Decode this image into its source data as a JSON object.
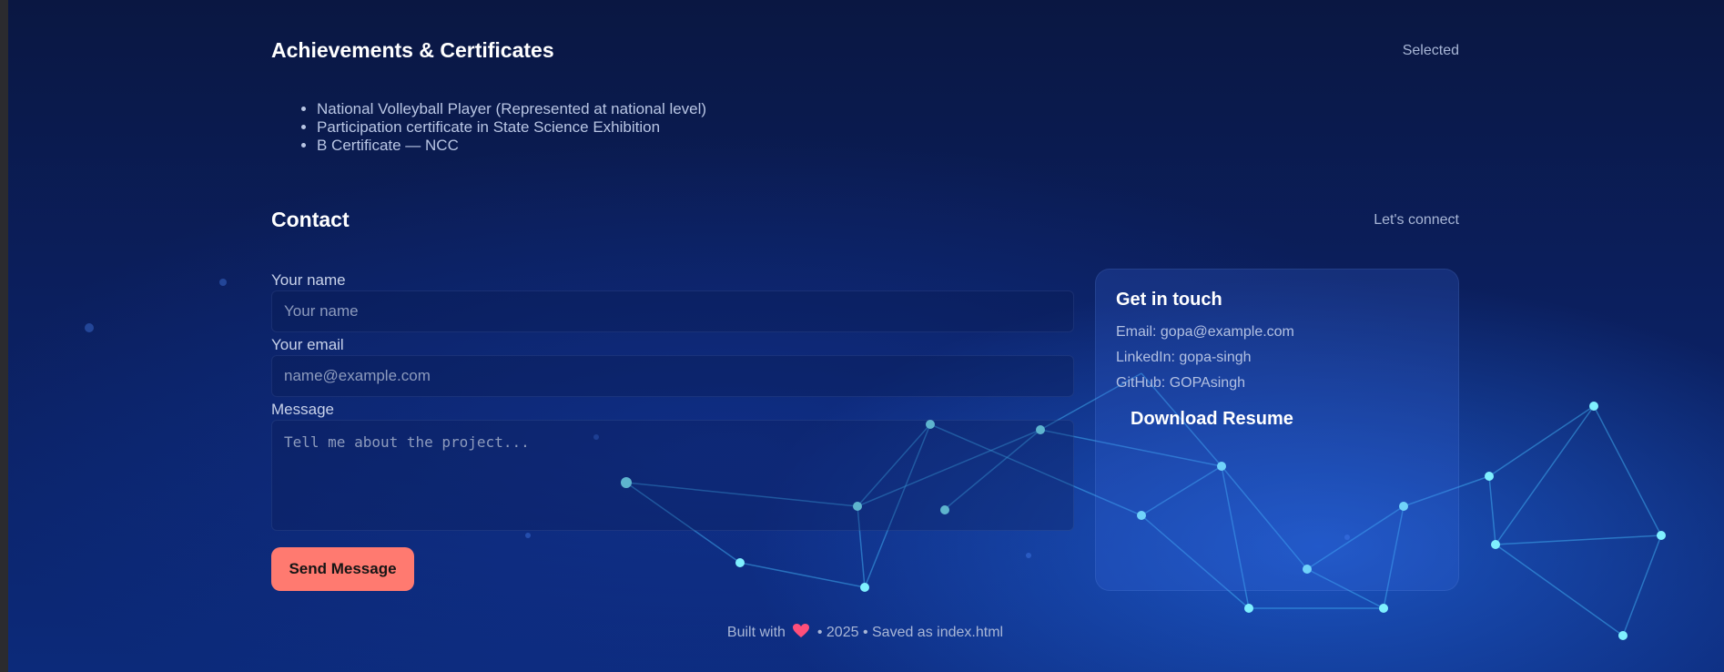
{
  "achievements": {
    "title": "Achievements & Certificates",
    "tag": "Selected",
    "items": [
      "National Volleyball Player (Represented at national level)",
      "Participation certificate in State Science Exhibition",
      "B Certificate — NCC"
    ]
  },
  "contact": {
    "title": "Contact",
    "tag": "Let's connect",
    "form": {
      "name_label": "Your name",
      "name_placeholder": "Your name",
      "email_label": "Your email",
      "email_placeholder": "name@example.com",
      "message_label": "Message",
      "message_placeholder": "Tell me about the project...",
      "send_label": "Send Message"
    },
    "card": {
      "title": "Get in touch",
      "email": "Email: gopa@example.com",
      "linkedin": "LinkedIn: gopa-singh",
      "github": "GitHub: GOPAsingh",
      "download_label": "Download Resume"
    }
  },
  "footer": {
    "built_with": "Built with",
    "heart_icon": "heart-icon",
    "rest": "• 2025 • Saved as index.html"
  },
  "colors": {
    "accent_button": "#ff7a70",
    "heart": "#ff4f7a",
    "background": "#0b1f5e"
  }
}
